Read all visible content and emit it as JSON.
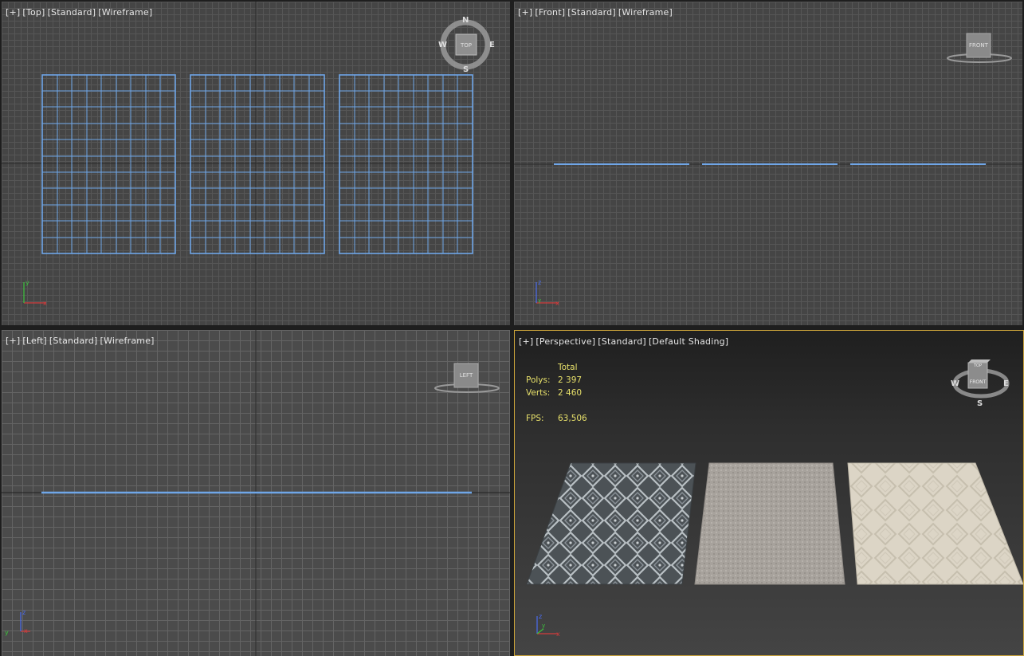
{
  "viewports": {
    "top": {
      "plus": "[+]",
      "view": "[Top]",
      "style": "[Standard]",
      "mode": "[Wireframe]",
      "cube_face": "TOP",
      "compass": {
        "n": "N",
        "s": "S",
        "e": "E",
        "w": "W"
      }
    },
    "front": {
      "plus": "[+]",
      "view": "[Front]",
      "style": "[Standard]",
      "mode": "[Wireframe]",
      "cube_face": "FRONT"
    },
    "left": {
      "plus": "[+]",
      "view": "[Left]",
      "style": "[Standard]",
      "mode": "[Wireframe]",
      "cube_face": "LEFT"
    },
    "perspective": {
      "plus": "[+]",
      "view": "[Perspective]",
      "style": "[Standard]",
      "mode": "[Default Shading]",
      "cube_top": "TOP",
      "cube_front": "FRONT",
      "compass": {
        "s": "S",
        "e": "E",
        "w": "W"
      },
      "stats": {
        "header": "Total",
        "polys_label": "Polys:",
        "polys": "2 397",
        "verts_label": "Verts:",
        "verts": "2 460",
        "fps_label": "FPS:",
        "fps": "63,506"
      }
    }
  },
  "axes": {
    "x": "x",
    "y": "y",
    "z": "z"
  },
  "colors": {
    "wire": "#6fa6e8",
    "active_border": "#c9a23a",
    "stats_text": "#e7e06a",
    "axis_x": "#d23c3c",
    "axis_y": "#3cc23c",
    "axis_z": "#4a6cf0"
  }
}
